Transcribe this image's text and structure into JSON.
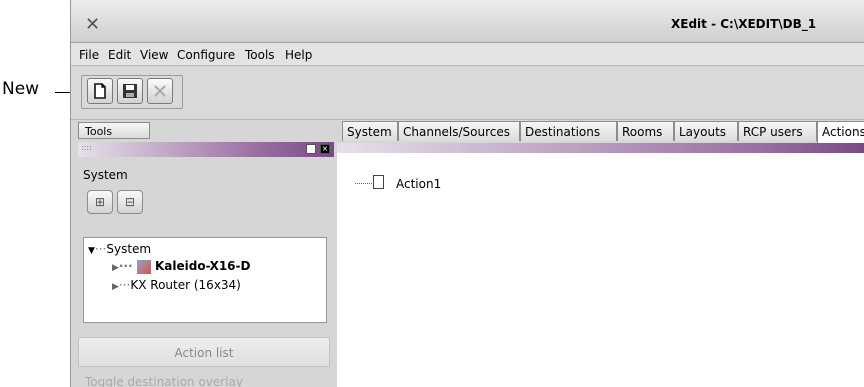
{
  "callout": {
    "label": "New"
  },
  "window": {
    "title": "XEdit - C:\\XEDIT\\DB_1"
  },
  "menu": [
    "File",
    "Edit",
    "View",
    "Configure",
    "Tools",
    "Help"
  ],
  "toolbar": {
    "buttons": [
      "new-document-icon",
      "save-icon",
      "close-x-icon"
    ]
  },
  "left_panel": {
    "tab_label": "Tools",
    "system_label": "System",
    "tree": {
      "root": "System",
      "children": [
        "Kaleido-X16-D",
        "KX Router (16x34)"
      ]
    },
    "action_list_button": "Action list",
    "toggle_label": "Toggle destination overlay"
  },
  "tabs": [
    "System",
    "Channels/Sources",
    "Destinations",
    "Rooms",
    "Layouts",
    "RCP users",
    "Actions"
  ],
  "active_tab_index": 6,
  "content": {
    "items": [
      "Action1"
    ]
  },
  "colors": {
    "panel_accent": "#7a4a85",
    "background": "#d6d6d6"
  }
}
